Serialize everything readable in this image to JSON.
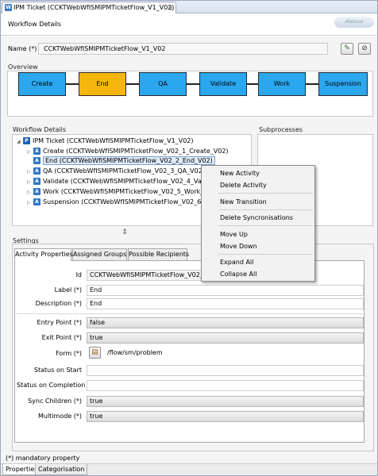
{
  "tab": {
    "icon": "W",
    "title": "IPM Ticket (CCKTWebWfISMIPMTicketFlow_V1_V02)",
    "close": "☒"
  },
  "header": {
    "title": "Workflow Details",
    "logo": "Aleksus"
  },
  "name": {
    "label": "Name (*)",
    "value": "CCKTWebWfISMIPMTicketFlow_V1_V02"
  },
  "overview": {
    "title": "Overview",
    "steps": [
      {
        "label": "Create",
        "color": "#2aa7ee"
      },
      {
        "label": "End",
        "color": "#f7b60d"
      },
      {
        "label": "QA",
        "color": "#2aa7ee"
      },
      {
        "label": "Validate",
        "color": "#2aa7ee"
      },
      {
        "label": "Work",
        "color": "#2aa7ee"
      },
      {
        "label": "Suspension",
        "color": "#2aa7ee"
      }
    ]
  },
  "workflow_details": {
    "title": "Workflow Details",
    "root": {
      "icon": "P",
      "label": "IPM Ticket (CCKTWebWfISMIPMTicketFlow_V1_V02)"
    },
    "items": [
      {
        "icon": "A",
        "label": "Create (CCKTWebWfISMIPMTicketFlow_V02_1_Create_V02)"
      },
      {
        "icon": "A",
        "label": "End (CCKTWebWfISMIPMTicketFlow_V02_2_End_V02)"
      },
      {
        "icon": "A",
        "label": "QA (CCKTWebWfISMIPMTicketFlow_V02_3_QA_V02)"
      },
      {
        "icon": "A",
        "label": "Validate (CCKTWebWfISMIPMTicketFlow_V02_4_Valid"
      },
      {
        "icon": "A",
        "label": "Work (CCKTWebWfISMIPMTicketFlow_V02_5_Work_V"
      },
      {
        "icon": "A",
        "label": "Suspension (CCKTWebWfISMIPMTicketFlow_V02_6_Su"
      }
    ]
  },
  "subprocesses": {
    "title": "Subprocesses"
  },
  "context_menu": {
    "items": [
      "New Activity",
      "Delete Activity",
      "New Transition",
      "Delete Syncronisations",
      "Move Up",
      "Move Down",
      "Expand All",
      "Collapse All"
    ]
  },
  "settings": {
    "title": "Settings",
    "tabs": [
      "Activity Properties",
      "Assigned Groups",
      "Possible Recipients"
    ],
    "fields": {
      "id": {
        "label": "Id",
        "value": "CCKTWebWfISMIPMTicketFlow_V02_2"
      },
      "label": {
        "label": "Label (*)",
        "value": "End"
      },
      "description": {
        "label": "Description (*)",
        "value": "End"
      },
      "entry_point": {
        "label": "Entry Point (*)",
        "value": "false"
      },
      "exit_point": {
        "label": "Exit Point (*)",
        "value": "true"
      },
      "form": {
        "label": "Form (*)",
        "value": "/flow/sm/problem"
      },
      "status_on_start": {
        "label": "Status on Start",
        "value": ""
      },
      "status_on_completion": {
        "label": "Status on Completion",
        "value": ""
      },
      "sync_children": {
        "label": "Sync Children (*)",
        "value": "true"
      },
      "multimode": {
        "label": "Multimode (*)",
        "value": "true"
      }
    },
    "footnote": "(*) mandatory property"
  },
  "bottom_tabs": [
    "Properties",
    "Categorisation"
  ]
}
